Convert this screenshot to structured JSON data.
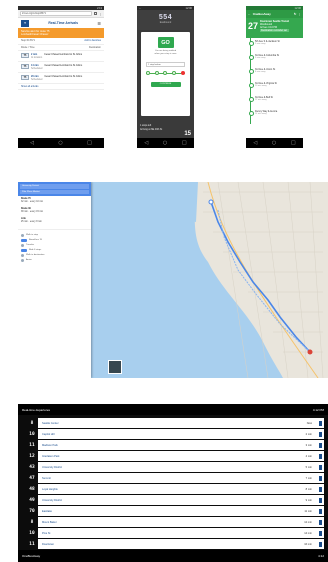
{
  "phone1": {
    "status_time": "2:13",
    "url": "trimet.org/m/stop/8371",
    "logo_text": "T",
    "title": "Real-Time Arrivals",
    "alert": [
      "Service alert for route 75",
      "Lombard/Cesar Chavez"
    ],
    "stop_label": "Stop ID 8371",
    "stop_link": "Add to favorites",
    "col_left": "Route / Time",
    "col_right": "Destination",
    "trips": [
      {
        "route": "75",
        "time": "2 min",
        "dest": "Cesar Chavez/Lombard to St Johns",
        "note": "At location"
      },
      {
        "route": "75",
        "time": "14 min",
        "dest": "Cesar Chavez/Lombard to St Johns",
        "note": "Scheduled"
      },
      {
        "route": "75",
        "time": "26 min",
        "dest": "Cesar Chavez/Lombard to St Johns",
        "note": "Scheduled"
      }
    ],
    "more": "Show all arrivals",
    "nav": [
      "◁",
      "○",
      "□"
    ]
  },
  "phone2": {
    "status_time": "12:00",
    "bus": "554",
    "sub": "Eastbound",
    "go": "GO",
    "lines": [
      "You are being notified",
      "when your stop is near"
    ],
    "select": "1 stop before",
    "continue": "CONTINUE",
    "foot1": "1 stops left",
    "foot2": "Arriving at NE 40th St",
    "foot_num": "15",
    "nav": [
      "◁",
      "○",
      "□"
    ]
  },
  "phone3": {
    "status_time": "12:00",
    "bar_title": "OneBusAway",
    "minutes": "27",
    "hero_lines": [
      "Downtown Seattle Transit",
      "Westbound",
      "Arrives 4:10 PM"
    ],
    "hero_hi": "Destination reminder set",
    "stops": [
      {
        "name": "5th Ave S & Jackson St",
        "sub": "2 min away"
      },
      {
        "name": "3rd Ave & Columbia St",
        "sub": "5 min away"
      },
      {
        "name": "3rd Ave & Union St",
        "sub": "8 min away"
      },
      {
        "name": "3rd Ave & Virginia St",
        "sub": "10 min away"
      },
      {
        "name": "3rd Ave & Bell St",
        "sub": "12 min away"
      },
      {
        "name": "Denny Way & Aurora",
        "sub": "14 min away"
      }
    ],
    "nav": [
      "◁",
      "○",
      "□"
    ]
  },
  "map": {
    "from": "University District",
    "to": "Pike Place Market",
    "results": [
      {
        "title": "Route 70",
        "sub": "32 min · every 10 min"
      },
      {
        "title": "Route 49",
        "sub": "38 min · every 15 min"
      },
      {
        "title": "Link",
        "sub": "25 min · every 8 min"
      }
    ],
    "steps": [
      "Walk to stop",
      "Board bus 70",
      "Transfer",
      "Ride 6 stops",
      "Walk to destination",
      "Arrive"
    ]
  },
  "terminal": {
    "title": "Real-time departures",
    "clock": "4:12 PM",
    "rows": [
      {
        "code": "8",
        "dest": "Seattle Center",
        "eta": "Now"
      },
      {
        "code": "10",
        "dest": "Capitol Hill",
        "eta": "2 min"
      },
      {
        "code": "11",
        "dest": "Madison Park",
        "eta": "3 min"
      },
      {
        "code": "12",
        "dest": "Interlaken Park",
        "eta": "4 min"
      },
      {
        "code": "43",
        "dest": "University District",
        "eta": "5 min"
      },
      {
        "code": "47",
        "dest": "Summit",
        "eta": "7 min"
      },
      {
        "code": "48",
        "dest": "Loyal Heights",
        "eta": "8 min"
      },
      {
        "code": "49",
        "dest": "University District",
        "eta": "9 min"
      },
      {
        "code": "70",
        "dest": "Eastlake",
        "eta": "11 min"
      },
      {
        "code": "8",
        "dest": "Mount Baker",
        "eta": "12 min"
      },
      {
        "code": "10",
        "dest": "Pine St",
        "eta": "14 min"
      },
      {
        "code": "11",
        "dest": "Downtown",
        "eta": "16 min"
      }
    ],
    "brand": "OneBusAway",
    "foot_right": "4:12"
  },
  "colors": {
    "accent": "#2fa84f",
    "brand_blue": "#1c4f8f",
    "alert": "#f49a2c",
    "map_water": "#a8cfee",
    "route": "#4a86e8"
  }
}
